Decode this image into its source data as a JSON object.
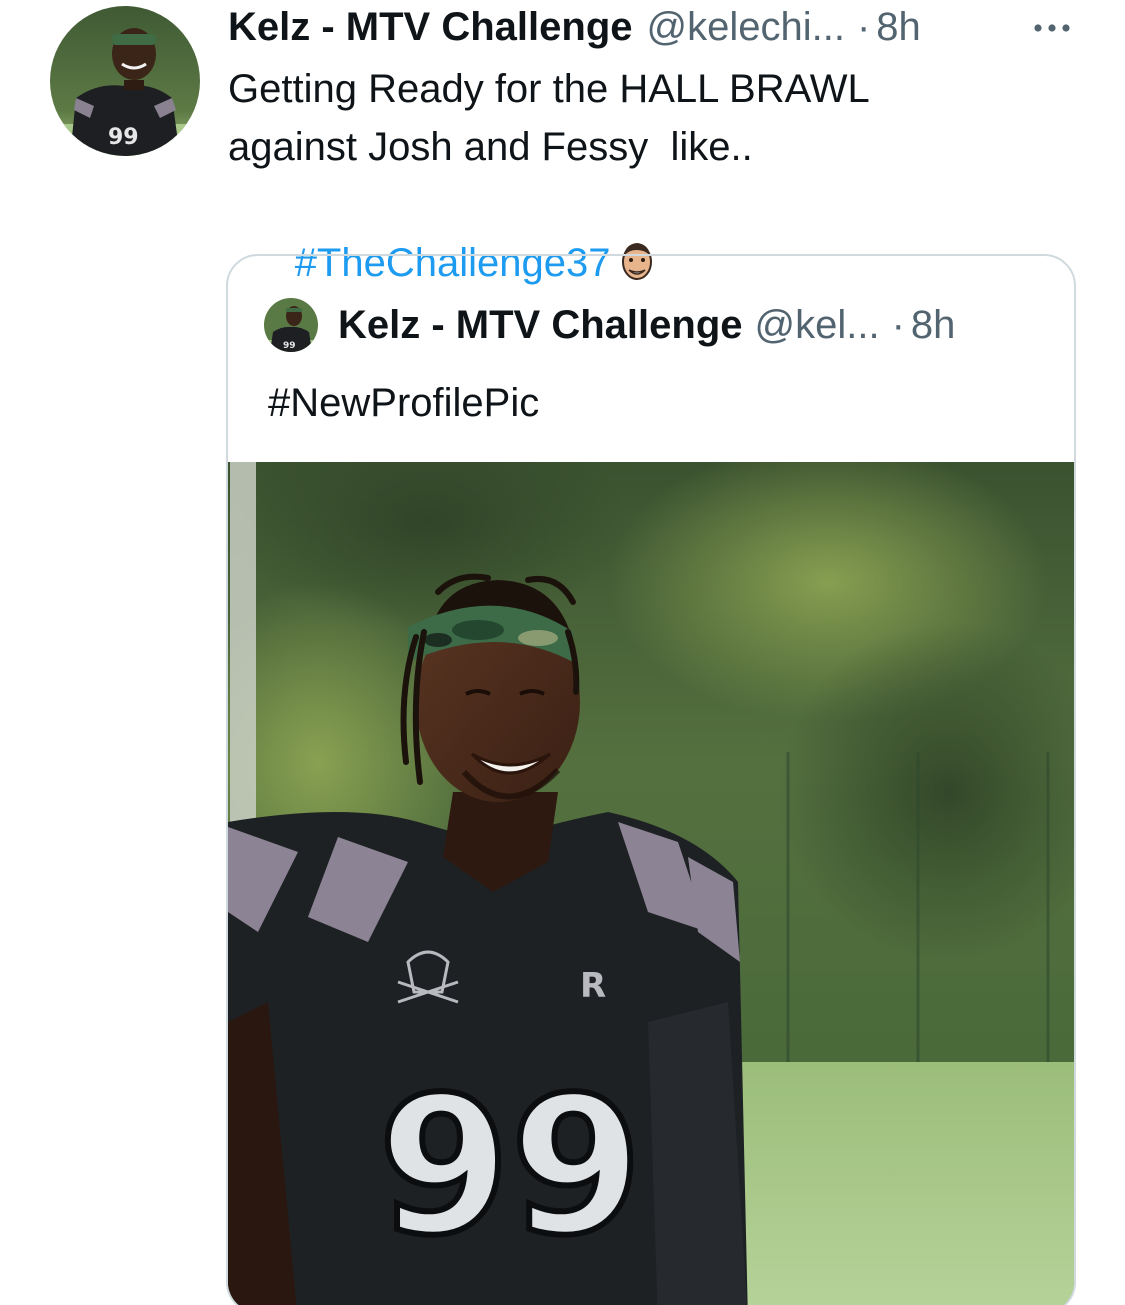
{
  "tweet": {
    "author_name": "Kelz - MTV Challenge",
    "author_handle": "@kelechi...",
    "separator": "·",
    "time": "8h",
    "more_label": "···",
    "text_lines": [
      "Getting Ready for the HALL BRAWL",
      "against Josh and Fessy  like.."
    ],
    "hashtag": "#TheChallenge37",
    "emoji": "hashtag-emoji-face"
  },
  "quote": {
    "author_name": "Kelz - MTV Challenge",
    "author_handle": "@kel...",
    "separator": "·",
    "time": "8h",
    "text": "#NewProfilePic",
    "media_jersey_number": "99"
  },
  "colors": {
    "text_primary": "#0f1419",
    "text_secondary": "#536471",
    "link": "#1d9bf0",
    "border": "#cfd9de"
  }
}
